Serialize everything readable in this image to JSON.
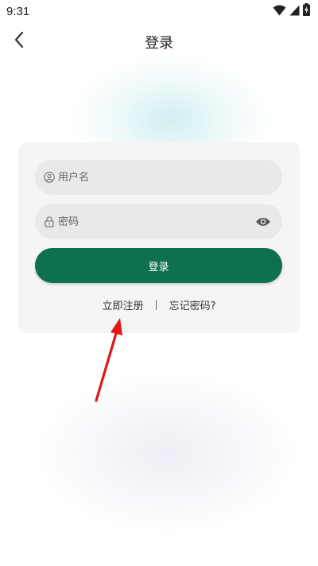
{
  "status_bar": {
    "time": "9:31",
    "icons": [
      "wifi-icon",
      "signal-icon",
      "battery-charging-icon"
    ]
  },
  "header": {
    "title": "登录",
    "back_icon": "chevron-left-icon"
  },
  "form": {
    "username": {
      "placeholder": "用户名",
      "value": "",
      "icon": "user-icon"
    },
    "password": {
      "placeholder": "密码",
      "value": "",
      "icon": "lock-icon",
      "toggle_icon": "eye-icon"
    },
    "login_label": "登录",
    "register_label": "立即注册",
    "separator": "|",
    "forgot_label": "忘记密码?"
  },
  "colors": {
    "primary": "#0d7050",
    "card_bg": "#f5f5f5",
    "field_bg": "#e9e9e9",
    "annotation_arrow": "#e01818"
  }
}
